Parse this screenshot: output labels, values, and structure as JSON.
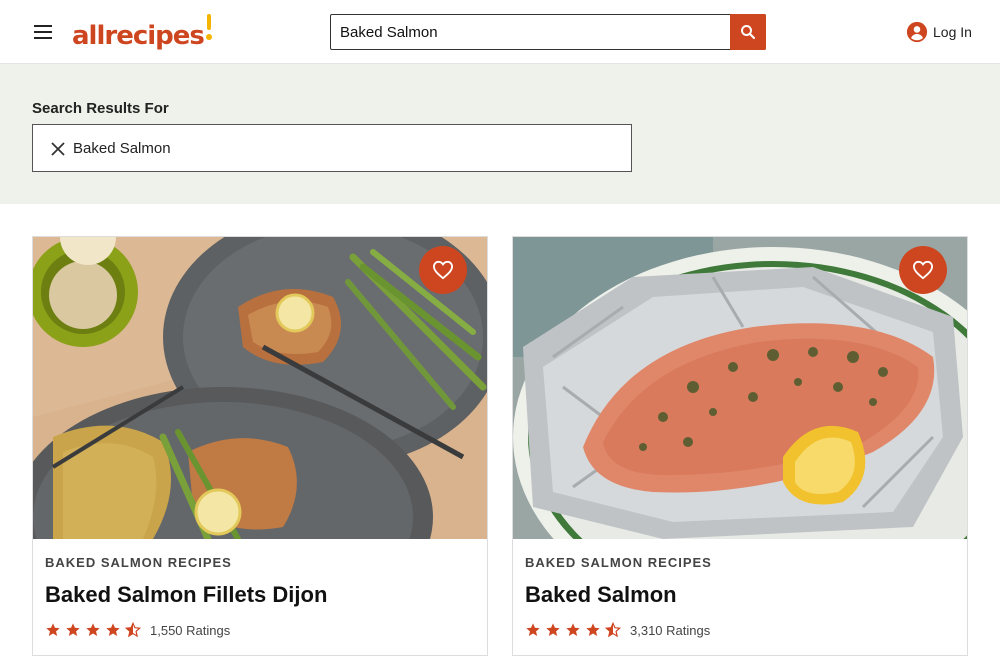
{
  "header": {
    "logo_text": "allrecipes",
    "search_value": "Baked Salmon",
    "login_label": "Log In"
  },
  "search_results": {
    "heading": "Search Results For",
    "term": "Baked Salmon"
  },
  "cards": [
    {
      "category": "BAKED SALMON RECIPES",
      "title": "Baked Salmon Fillets Dijon",
      "rating": 4.5,
      "ratings_count": "1,550 Ratings",
      "image": "salmon-dijon-plate-with-rice-and-asparagus"
    },
    {
      "category": "BAKED SALMON RECIPES",
      "title": "Baked Salmon",
      "rating": 4.5,
      "ratings_count": "3,310 Ratings",
      "image": "salmon-fillet-in-foil-with-lemon"
    }
  ],
  "colors": {
    "brand": "#ce4620",
    "accent_yellow": "#f5b400",
    "band_bg": "#eef2ea"
  }
}
